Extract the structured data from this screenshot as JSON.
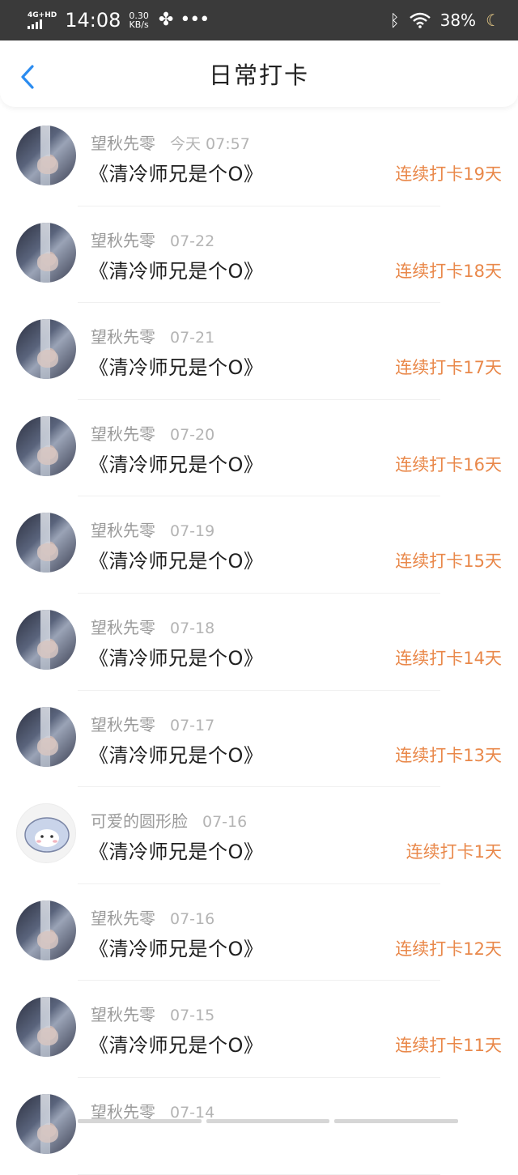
{
  "status_bar": {
    "network": "4G+HD",
    "time": "14:08",
    "speed_value": "0.30",
    "speed_unit": "KB/s",
    "battery": "38%",
    "icons": [
      "signal-icon",
      "fan-icon",
      "more-icon",
      "bluetooth-icon",
      "wifi-icon",
      "moon-icon"
    ]
  },
  "nav": {
    "title": "日常打卡",
    "back_icon": "chevron-left-icon",
    "accent_color": "#2b8cf0"
  },
  "colors": {
    "streak": "#e9884a",
    "name": "#9a9a9a",
    "date": "#b4b4b4",
    "book": "#1f1f1f"
  },
  "checkins": [
    {
      "user": "望秋先零",
      "date": "今天 07:57",
      "book": "《清冷师兄是个O》",
      "streak": "连续打卡19天",
      "avatar": "photo"
    },
    {
      "user": "望秋先零",
      "date": "07-22",
      "book": "《清冷师兄是个O》",
      "streak": "连续打卡18天",
      "avatar": "photo"
    },
    {
      "user": "望秋先零",
      "date": "07-21",
      "book": "《清冷师兄是个O》",
      "streak": "连续打卡17天",
      "avatar": "photo"
    },
    {
      "user": "望秋先零",
      "date": "07-20",
      "book": "《清冷师兄是个O》",
      "streak": "连续打卡16天",
      "avatar": "photo"
    },
    {
      "user": "望秋先零",
      "date": "07-19",
      "book": "《清冷师兄是个O》",
      "streak": "连续打卡15天",
      "avatar": "photo"
    },
    {
      "user": "望秋先零",
      "date": "07-18",
      "book": "《清冷师兄是个O》",
      "streak": "连续打卡14天",
      "avatar": "photo"
    },
    {
      "user": "望秋先零",
      "date": "07-17",
      "book": "《清冷师兄是个O》",
      "streak": "连续打卡13天",
      "avatar": "photo"
    },
    {
      "user": "可爱的圆形脸",
      "date": "07-16",
      "book": "《清冷师兄是个O》",
      "streak": "连续打卡1天",
      "avatar": "sheep"
    },
    {
      "user": "望秋先零",
      "date": "07-16",
      "book": "《清冷师兄是个O》",
      "streak": "连续打卡12天",
      "avatar": "photo"
    },
    {
      "user": "望秋先零",
      "date": "07-15",
      "book": "《清冷师兄是个O》",
      "streak": "连续打卡11天",
      "avatar": "photo"
    },
    {
      "user": "望秋先零",
      "date": "07-14",
      "book": "",
      "streak": "",
      "avatar": "photo"
    }
  ]
}
